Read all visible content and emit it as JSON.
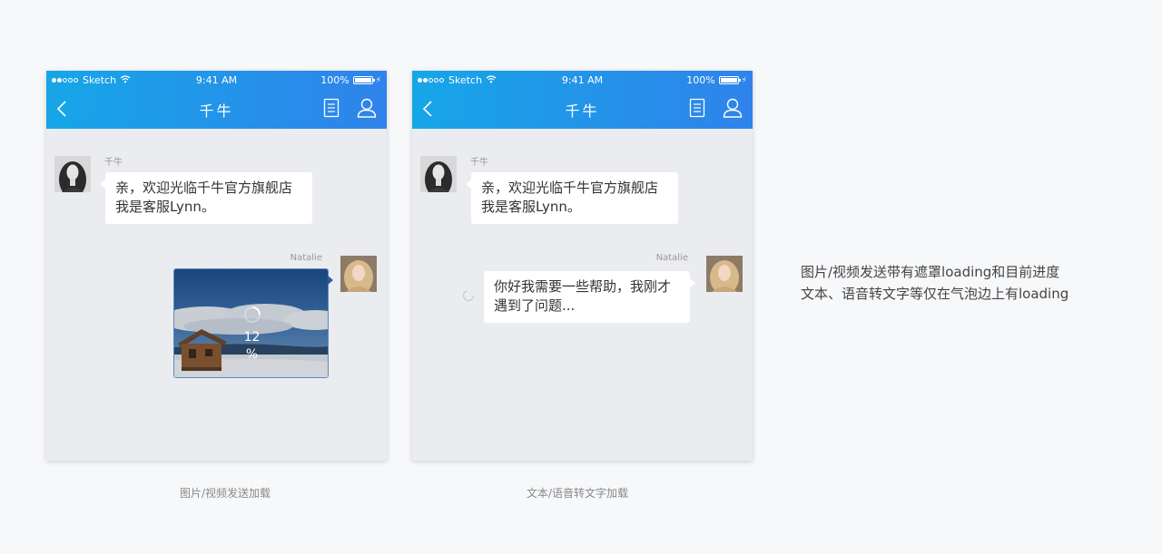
{
  "status_bar": {
    "carrier": "Sketch",
    "time": "9:41 AM",
    "battery": "100%",
    "battery_level": 1.0
  },
  "nav": {
    "title": "千牛",
    "back_icon": "chevron-left-icon",
    "doc_icon": "document-icon",
    "user_icon": "user-icon"
  },
  "colors": {
    "nav_gradient_start": "#16a6e8",
    "nav_gradient_end": "#2f83ea",
    "chat_background": "#ebecf0",
    "page_background": "#f7f8fa"
  },
  "screen1": {
    "agent_name": "千牛",
    "agent_message_line1": "亲，欢迎光临千牛官方旗舰店",
    "agent_message_line2": "我是客服Lynn。",
    "user_name": "Natalie",
    "upload_progress": "12",
    "upload_unit": "%",
    "caption": "图片/视频发送加载"
  },
  "screen2": {
    "agent_name": "千牛",
    "agent_message_line1": "亲，欢迎光临千牛官方旗舰店",
    "agent_message_line2": "我是客服Lynn。",
    "user_name": "Natalie",
    "user_message_line1": "你好我需要一些帮助，我刚才",
    "user_message_line2": "遇到了问题...",
    "caption": "文本/语音转文字加载"
  },
  "notes": {
    "line1": "图片/视频发送带有遮罩loading和目前进度",
    "line2": "文本、语音转文字等仅在气泡边上有loading"
  }
}
